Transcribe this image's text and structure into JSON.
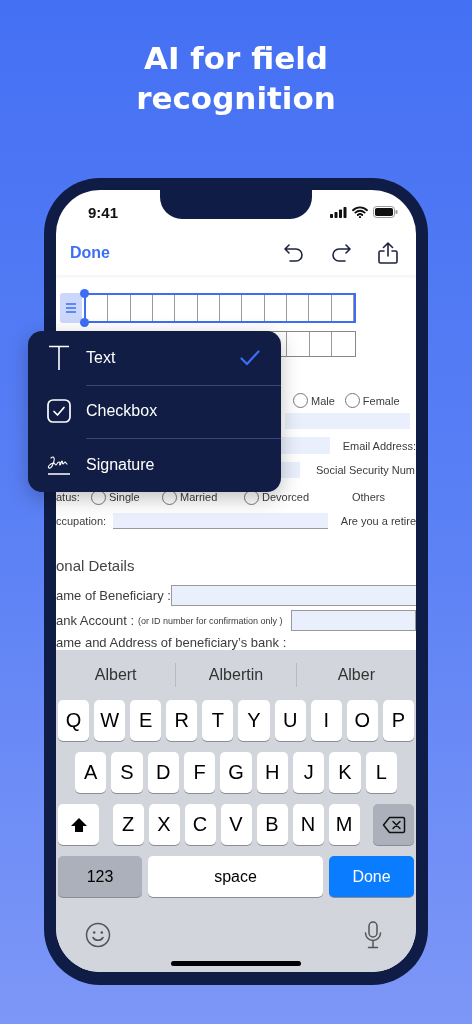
{
  "headline": "AI for field\nrecognition",
  "status_bar": {
    "time": "9:41"
  },
  "nav": {
    "done": "Done"
  },
  "form": {
    "comb_fields": [
      {
        "selected": true
      },
      {
        "selected": false
      }
    ],
    "gender_options": [
      {
        "label": "Male",
        "selected": false
      },
      {
        "label": "Female",
        "selected": false
      }
    ],
    "email_label": "Email Address:",
    "ssn_label": "Social Security Num",
    "status_label": "atus:",
    "status_options": [
      {
        "label": "Single",
        "selected": false
      },
      {
        "label": "Married",
        "selected": false
      },
      {
        "label": "Devorced",
        "selected": false
      }
    ],
    "others_label": "Others",
    "occupation_label": "ccupation:",
    "retired_label": "Are you a retire",
    "section_heading": "onal Details",
    "beneficiary_label": "ame of Beneficiary :",
    "bank_account_label": "ank Account :",
    "bank_account_note": "(or ID number for confirmation only )",
    "bank_address_label": "ame and Address of beneficiary’s bank :"
  },
  "field_menu": {
    "items": [
      {
        "kind": "text",
        "label": "Text",
        "selected": true
      },
      {
        "kind": "checkbox",
        "label": "Checkbox",
        "selected": false
      },
      {
        "kind": "signature",
        "label": "Signature",
        "selected": false
      }
    ]
  },
  "keyboard": {
    "suggestions": [
      "Albert",
      "Albertin",
      "Alber"
    ],
    "rows": [
      [
        "Q",
        "W",
        "E",
        "R",
        "T",
        "Y",
        "U",
        "I",
        "O",
        "P"
      ],
      [
        "A",
        "S",
        "D",
        "F",
        "G",
        "H",
        "J",
        "K",
        "L"
      ],
      [
        "Z",
        "X",
        "C",
        "V",
        "B",
        "N",
        "M"
      ]
    ],
    "numbers_key": "123",
    "space_key": "space",
    "done_key": "Done"
  }
}
